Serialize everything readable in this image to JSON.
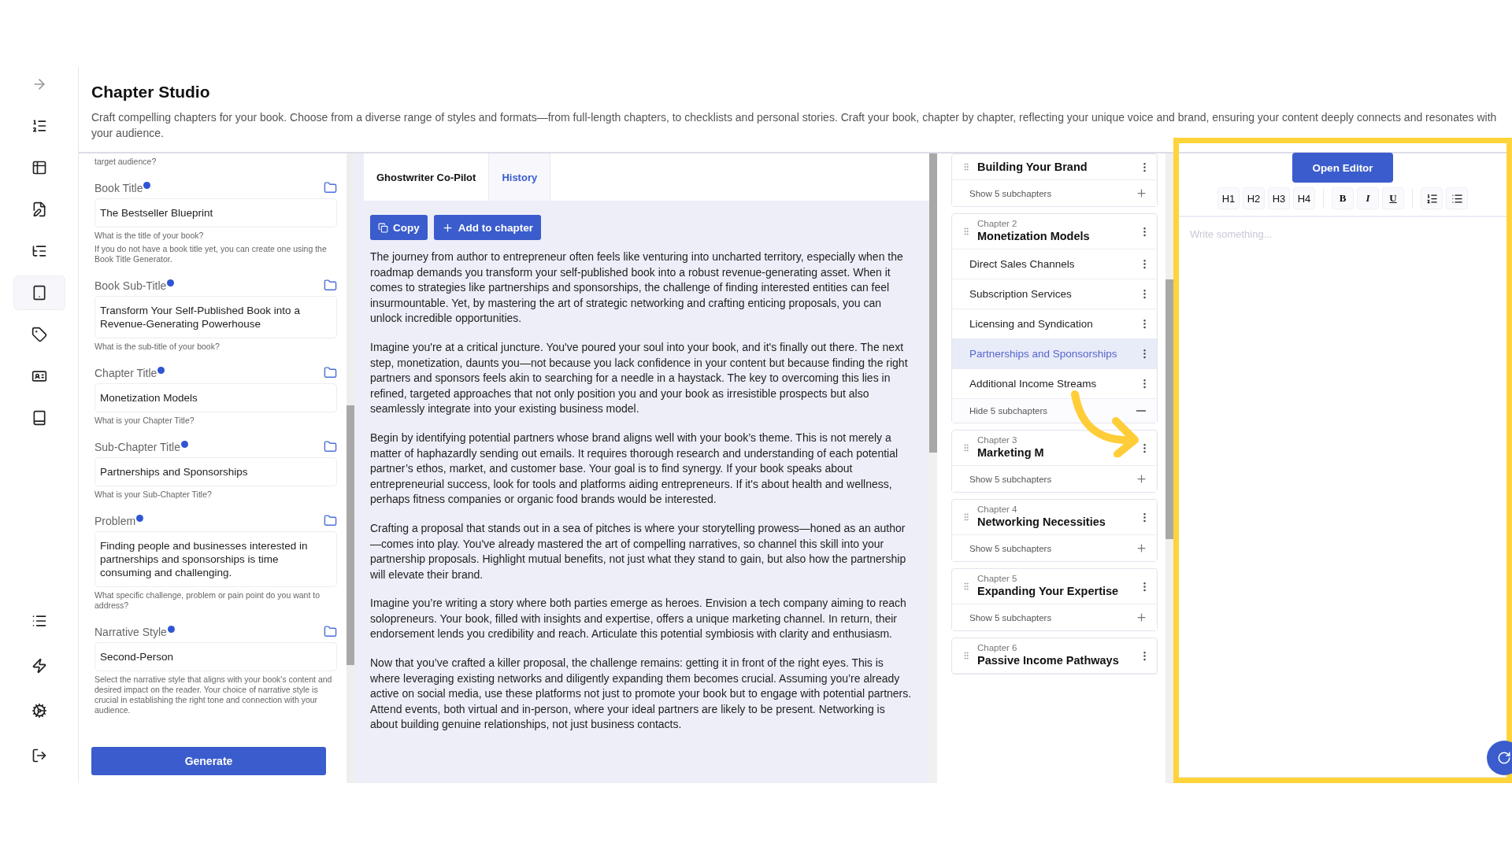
{
  "sidebar": {
    "items": [
      {
        "selected": false
      },
      {
        "selected": false
      },
      {
        "selected": false
      },
      {
        "selected": false
      },
      {
        "selected": false
      },
      {
        "selected": true
      },
      {
        "selected": false
      },
      {
        "selected": false
      },
      {
        "selected": false
      }
    ],
    "bottom_items": [
      {
        "selected": false
      },
      {
        "selected": false
      },
      {
        "selected": false
      },
      {
        "selected": false
      }
    ]
  },
  "header": {
    "title": "Chapter Studio",
    "description": "Craft compelling chapters for your book. Choose from a diverse range of styles and formats—from full-length chapters, to checklists and personal stories. Craft your book, chapter by chapter, reflecting your unique voice and brand, ensuring your content deeply connects and resonates with your audience."
  },
  "form": {
    "top_hint": "target audience?",
    "fields": [
      {
        "label": "Book Title",
        "value": "The Bestseller Blueprint",
        "hint": [
          "What is the title of your book?",
          "If you do not have a book title yet, you can create one using the Book Title Generator."
        ]
      },
      {
        "label": "Book Sub-Title",
        "value": "Transform Your Self-Published Book into a Revenue-Generating Powerhouse",
        "hint": [
          "What is the sub-title of your book?"
        ]
      },
      {
        "label": "Chapter Title",
        "value": "Monetization Models",
        "hint": [
          "What is your Chapter Title?"
        ]
      },
      {
        "label": "Sub-Chapter Title",
        "value": "Partnerships and Sponsorships",
        "hint": [
          "What is your Sub-Chapter Title?"
        ]
      },
      {
        "label": "Problem",
        "value": "Finding people and businesses interested in partnerships and sponsorships is time consuming and challenging.",
        "hint": [
          "What specific challenge, problem or pain point do you want to address?"
        ]
      },
      {
        "label": "Narrative Style",
        "value": "Second-Person",
        "hint": [
          "Select the narrative style that aligns with your book's content and desired impact on the reader. Your choice of narrative style is crucial in establishing the right tone and connection with your audience."
        ]
      }
    ],
    "generate": "Generate"
  },
  "copilot": {
    "tabs": [
      {
        "label": "Ghostwriter Co-Pilot",
        "selected": true
      },
      {
        "label": "History",
        "selected": false
      }
    ],
    "actions": [
      {
        "kind": "copy",
        "label": "Copy"
      },
      {
        "kind": "add",
        "label": "Add to chapter"
      }
    ],
    "paragraphs": [
      "The journey from author to entrepreneur often feels like venturing into uncharted territory, especially when the roadmap demands you transform your self-published book into a robust revenue-generating asset. When it comes to strategies like partnerships and sponsorships, the challenge of finding interested entities can feel insurmountable. Yet, by mastering the art of strategic networking and crafting enticing proposals, you can unlock incredible opportunities.",
      "Imagine you're at a critical juncture. You've poured your soul into your book, and it's finally out there. The next step, monetization, daunts you—not because you lack confidence in your content but because finding the right partners and sponsors feels akin to searching for a needle in a haystack. The key to overcoming this lies in refined, targeted approaches that not only position you and your book as irresistible prospects but also seamlessly integrate into your existing business model.",
      "Begin by identifying potential partners whose brand aligns well with your book’s theme. This is not merely a matter of haphazardly sending out emails. It requires thorough research and understanding of each potential partner’s ethos, market, and customer base. Your goal is to find synergy. If your book speaks about entrepreneurial success, look for tools and platforms aiding entrepreneurs. If it's about health and wellness, perhaps fitness companies or organic food brands would be interested.",
      "Crafting a proposal that stands out in a sea of pitches is where your storytelling prowess—honed as an author—comes into play. You've already mastered the art of compelling narratives, so channel this skill into your partnership proposals. Highlight mutual benefits, not just what they stand to gain, but also how the partnership will elevate their brand.",
      "Imagine you’re writing a story where both parties emerge as heroes. Envision a tech company aiming to reach solopreneurs. Your book, filled with insights and expertise, offers a unique marketing channel. In return, their endorsement lends you credibility and reach. Articulate this potential symbiosis with clarity and enthusiasm.",
      "Now that you’ve crafted a killer proposal, the challenge remains: getting it in front of the right eyes. This is where leveraging existing networks and diligently expanding them becomes crucial. Assuming you’re already active on social media, use these platforms not just to promote your book but to engage with potential partners. Attend events, both virtual and in-person, where your ideal partners are likely to be present. Networking is about building genuine relationships, not just business contacts."
    ]
  },
  "chapters": [
    {
      "title": "Building Your Brand",
      "toggle": "Show 5 subchapters",
      "expanded": false
    },
    {
      "number": "Chapter 2",
      "title": "Monetization Models",
      "toggle": "Hide 5 subchapters",
      "expanded": true,
      "subchapters": [
        {
          "title": "Direct Sales Channels",
          "selected": false
        },
        {
          "title": "Subscription Services",
          "selected": false
        },
        {
          "title": "Licensing and Syndication",
          "selected": false
        },
        {
          "title": "Partnerships and Sponsorships",
          "selected": true
        },
        {
          "title": "Additional Income Streams",
          "selected": false
        }
      ]
    },
    {
      "number": "Chapter 3",
      "title": "Marketing M",
      "toggle": "Show 5 subchapters",
      "expanded": false
    },
    {
      "number": "Chapter 4",
      "title": "Networking Necessities",
      "toggle": "Show 5 subchapters",
      "expanded": false
    },
    {
      "number": "Chapter 5",
      "title": "Expanding Your Expertise",
      "toggle": "Show 5 subchapters",
      "expanded": false
    },
    {
      "number": "Chapter 6",
      "title": "Passive Income Pathways"
    }
  ],
  "editor": {
    "open_button": "Open Editor",
    "tools": [
      {
        "kind": "text",
        "label": "H1"
      },
      {
        "kind": "text",
        "label": "H2"
      },
      {
        "kind": "text",
        "label": "H3"
      },
      {
        "kind": "text",
        "label": "H4"
      },
      {
        "kind": "sep"
      },
      {
        "kind": "bold",
        "label": "B"
      },
      {
        "kind": "italic",
        "label": "I"
      },
      {
        "kind": "underline",
        "label": "U"
      },
      {
        "kind": "sep"
      },
      {
        "kind": "ordered"
      },
      {
        "kind": "bullet"
      }
    ],
    "placeholder": "Write something..."
  }
}
